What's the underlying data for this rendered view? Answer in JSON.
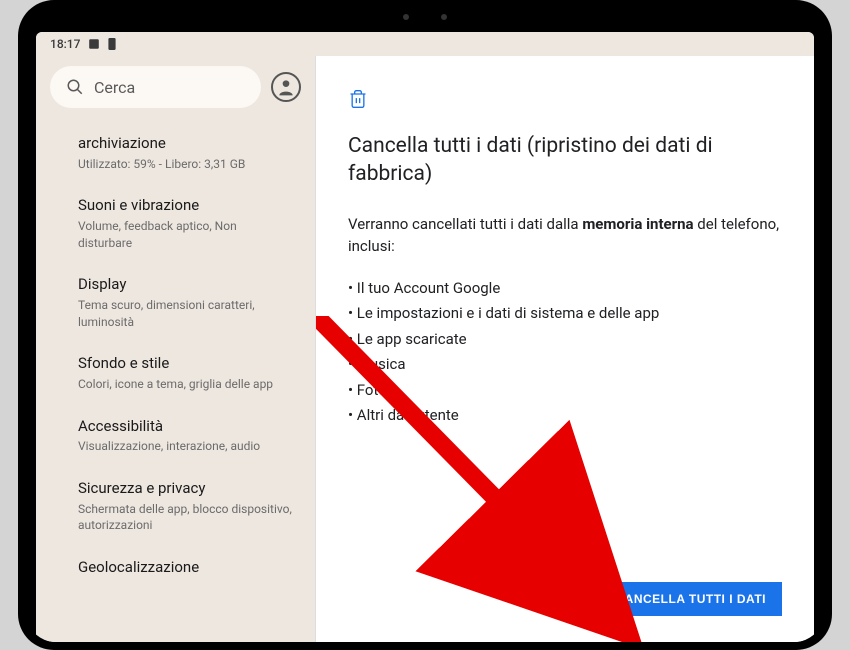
{
  "status": {
    "time": "18:17"
  },
  "search": {
    "placeholder": "Cerca"
  },
  "sidebar": {
    "items": [
      {
        "title": "archiviazione",
        "sub": "Utilizzato: 59% - Libero: 3,31 GB"
      },
      {
        "title": "Suoni e vibrazione",
        "sub": "Volume, feedback aptico, Non disturbare"
      },
      {
        "title": "Display",
        "sub": "Tema scuro, dimensioni caratteri, luminosità"
      },
      {
        "title": "Sfondo e stile",
        "sub": "Colori, icone a tema, griglia delle app"
      },
      {
        "title": "Accessibilità",
        "sub": "Visualizzazione, interazione, audio"
      },
      {
        "title": "Sicurezza e privacy",
        "sub": "Schermata delle app, blocco dispositivo, autorizzazioni"
      },
      {
        "title": "Geolocalizzazione",
        "sub": ""
      }
    ]
  },
  "main": {
    "title": "Cancella tutti i dati (ripristino dei dati di fabbrica)",
    "desc_pre": "Verranno cancellati tutti i dati dalla ",
    "desc_bold": "memoria interna",
    "desc_post": " del telefono, inclusi:",
    "bullets": [
      "Il tuo Account Google",
      "Le impostazioni e i dati di sistema e delle app",
      "Le app scaricate",
      "Musica",
      "Foto",
      "Altri dati utente"
    ],
    "button": "CANCELLA TUTTI I DATI"
  }
}
